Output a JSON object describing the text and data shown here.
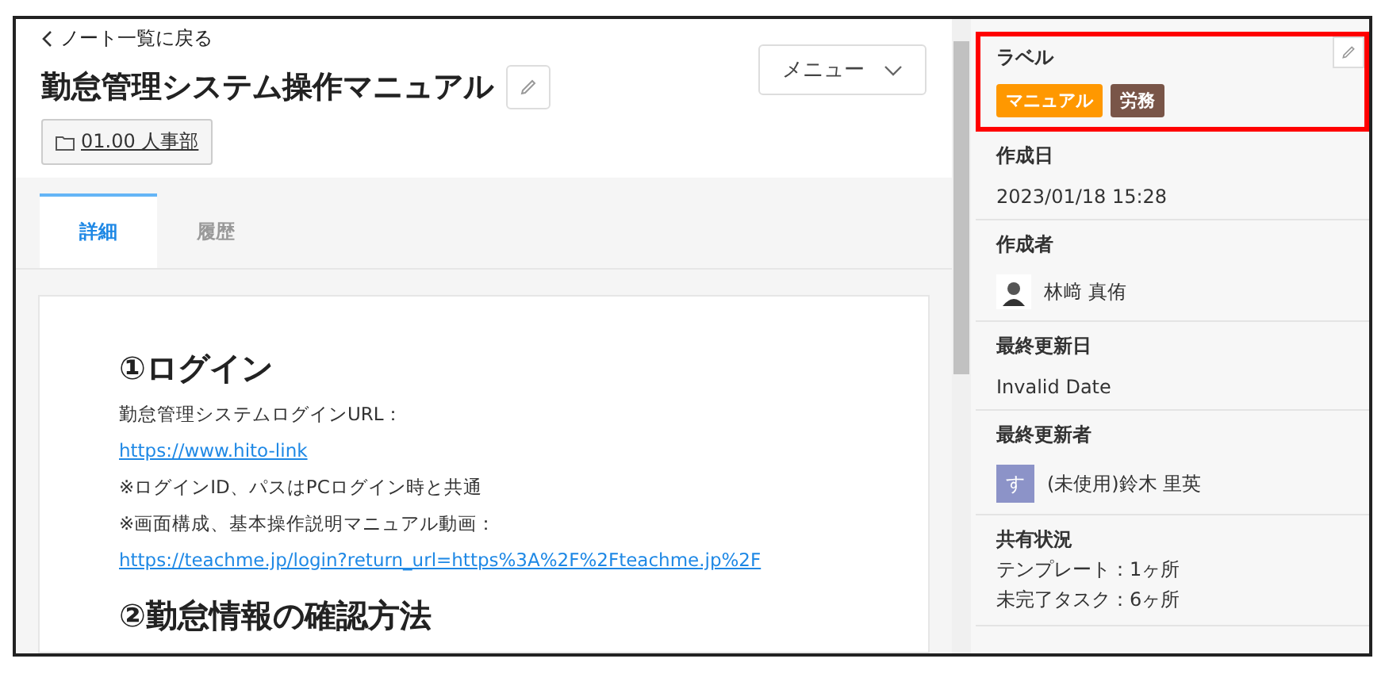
{
  "back_link": "ノート一覧に戻る",
  "title": "勤怠管理システム操作マニュアル",
  "folder": "01.00 人事部",
  "menu_button": "メニュー",
  "tabs": [
    {
      "label": "詳細",
      "selected": true
    },
    {
      "label": "履歴",
      "selected": false
    }
  ],
  "document": [
    {
      "kind": "heading",
      "text": "①ログイン"
    },
    {
      "kind": "text",
      "text": "勤怠管理システムログインURL：",
      "link": "https://www.hito-link"
    },
    {
      "kind": "text",
      "text": "※ログインID、パスはPCログイン時と共通"
    },
    {
      "kind": "text",
      "text": "※画面構成、基本操作説明マニュアル動画：",
      "link": "https://teachme.jp/login?return_url=https%3A%2F%2Fteachme.jp%2F"
    },
    {
      "kind": "heading",
      "text": "②勤怠情報の確認方法"
    }
  ],
  "sidebar": {
    "label_section": {
      "title": "ラベル",
      "tags": [
        {
          "text": "マニュアル",
          "color": "#ff9800"
        },
        {
          "text": "労務",
          "color": "#795548"
        }
      ]
    },
    "fields": [
      {
        "kind": "text",
        "title": "作成日",
        "value": "2023/01/18 15:28"
      },
      {
        "kind": "user",
        "title": "作成者",
        "value": "林﨑 真侑"
      },
      {
        "kind": "text",
        "title": "最終更新日",
        "value": "Invalid Date"
      },
      {
        "kind": "user",
        "title": "最終更新者",
        "value": "(未使用)鈴木 里英",
        "initial": "す"
      },
      {
        "kind": "lines",
        "title": "共有状況",
        "lines": [
          "テンプレート：1ヶ所",
          "未完了タスク：6ヶ所"
        ]
      }
    ]
  }
}
